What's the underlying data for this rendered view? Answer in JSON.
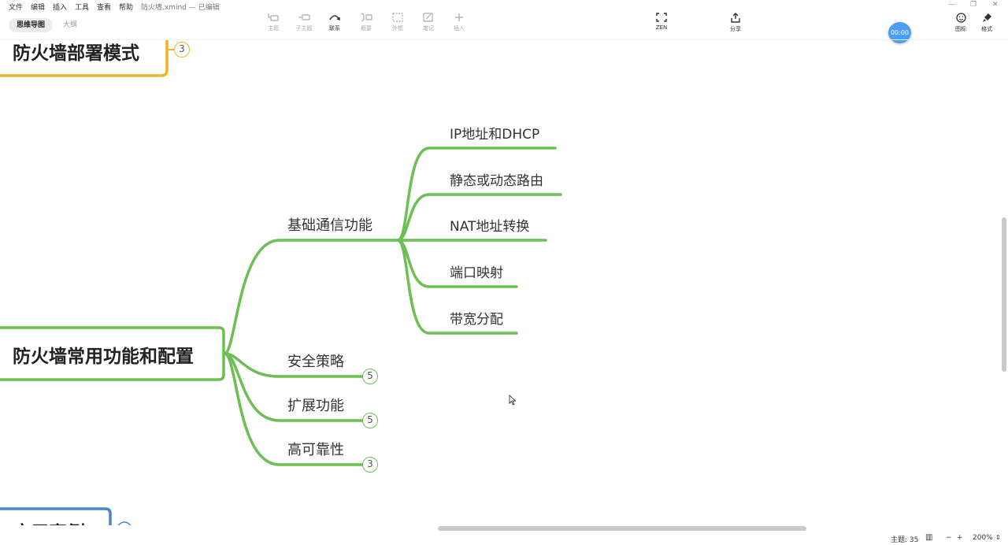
{
  "menu": {
    "items": [
      "文件",
      "编辑",
      "插入",
      "工具",
      "查看",
      "帮助"
    ],
    "document_title": "防火墙.xmind — 已编辑"
  },
  "view_tabs": {
    "mindmap": "思维导图",
    "outline": "大纲"
  },
  "toolbar": {
    "topic": "主题",
    "subtopic": "子主题",
    "relationship": "联系",
    "summary": "概要",
    "boundary": "外框",
    "note": "笔记",
    "insert": "插入",
    "zen": "ZEN",
    "share": "分享",
    "icons": "图标",
    "format": "格式",
    "timer": "00:00"
  },
  "mindmap": {
    "top_topic": {
      "label": "防火墙部署模式",
      "badge": "3",
      "color": "#f0b428"
    },
    "main_topic": {
      "label": "防火墙常用功能和配置",
      "color": "#6cbf52",
      "subtopics": [
        {
          "label": "基础通信功能",
          "children": [
            "IP地址和DHCP",
            "静态或动态路由",
            "NAT地址转换",
            "端口映射",
            "带宽分配"
          ]
        },
        {
          "label": "安全策略",
          "badge": "5"
        },
        {
          "label": "扩展功能",
          "badge": "5"
        },
        {
          "label": "高可靠性",
          "badge": "3"
        }
      ]
    },
    "bottom_topic": {
      "label": "应用案例",
      "color": "#4a86c5"
    }
  },
  "statusbar": {
    "topic_count": "主题: 35",
    "zoom": "200%",
    "zoom_out": "−",
    "zoom_in": "+"
  },
  "colors": {
    "accent_green": "#6cbf52",
    "accent_yellow": "#f0b428",
    "accent_blue": "#4a86c5",
    "timer_blue": "#4a9ff5"
  }
}
